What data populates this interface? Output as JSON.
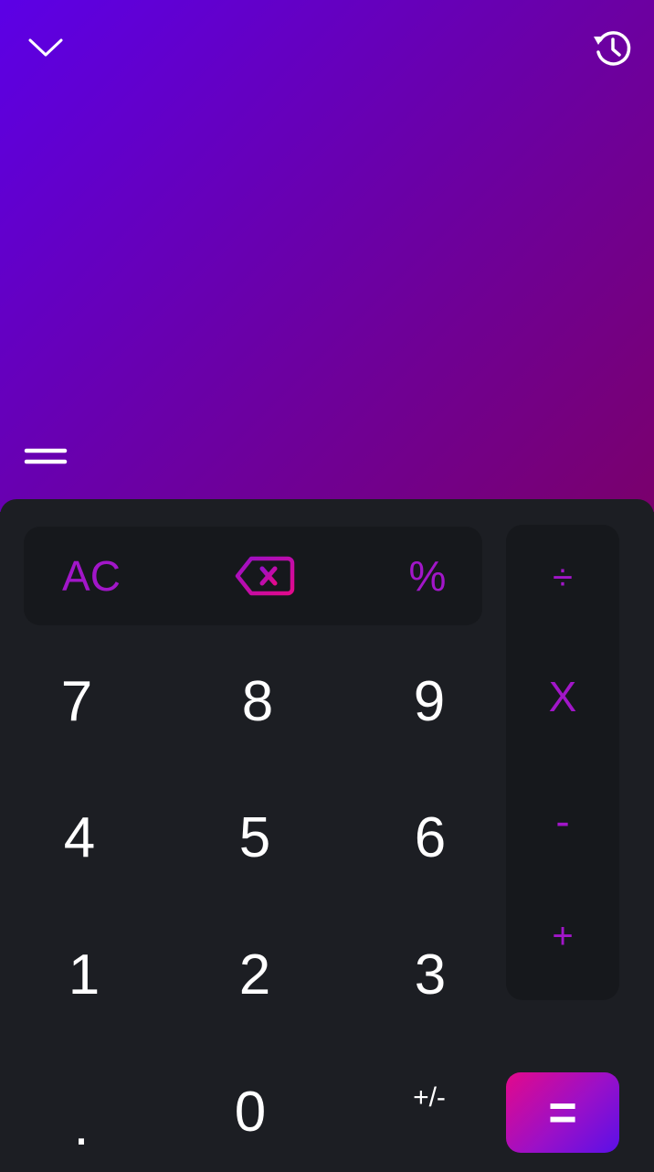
{
  "display": {
    "icons": {
      "collapse": "chevron-down-icon",
      "history": "history-icon",
      "menu": "menu-icon"
    },
    "gradient": [
      "#5c00e6",
      "#7a006c"
    ]
  },
  "keypad": {
    "function_keys": {
      "clear": "AC",
      "backspace_icon": "backspace-icon",
      "percent": "%"
    },
    "operators": {
      "divide": "÷",
      "multiply": "X",
      "subtract": "-",
      "add": "+"
    },
    "digits": {
      "seven": "7",
      "eight": "8",
      "nine": "9",
      "four": "4",
      "five": "5",
      "six": "6",
      "one": "1",
      "two": "2",
      "three": "3",
      "decimal": ".",
      "zero": "0",
      "sign": "+/-"
    },
    "equals": "=",
    "colors": {
      "accent": "#a216c9",
      "equals_gradient": [
        "#e3098b",
        "#5a10e8"
      ],
      "panel": "#16181c",
      "background": "#1c1e23"
    }
  }
}
